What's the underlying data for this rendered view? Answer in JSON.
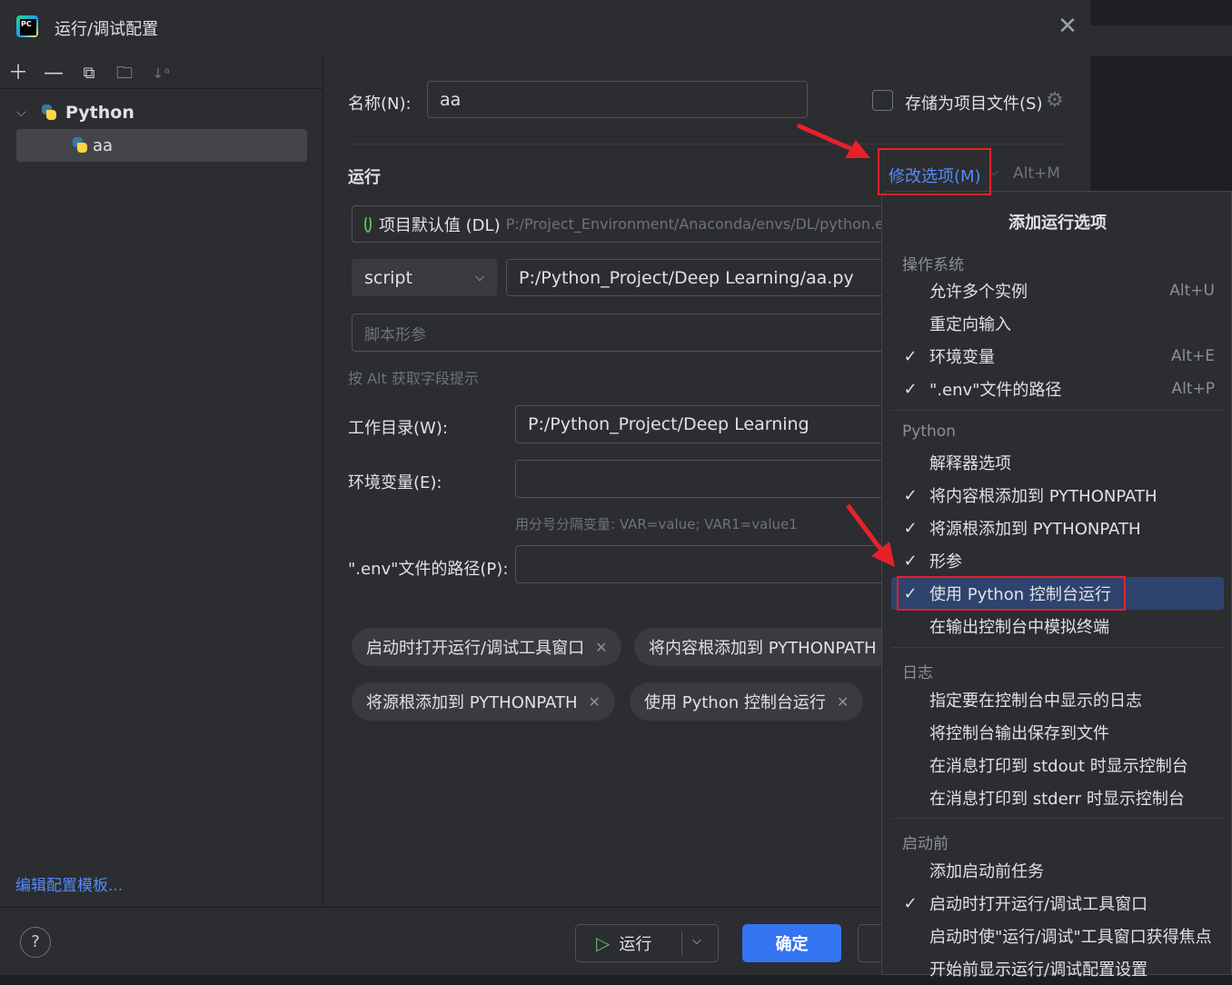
{
  "window": {
    "title": "运行/调试配置"
  },
  "tree": {
    "group_label": "Python",
    "item_label": "aa",
    "edit_templates_link": "编辑配置模板..."
  },
  "form": {
    "name_label": "名称(N):",
    "name_value": "aa",
    "store_as_file_label": "存储为项目文件(S)",
    "run_section": "运行",
    "modify_options_label": "修改选项(M)",
    "modify_options_shortcut": "Alt+M",
    "interpreter_name": "项目默认值 (DL)",
    "interpreter_path": "P:/Project_Environment/Anaconda/envs/DL/python.e",
    "script_type": "script",
    "script_path": "P:/Python_Project/Deep Learning/aa.py",
    "script_params_placeholder": "脚本形参",
    "alt_hint": "按 Alt 获取字段提示",
    "workdir_label": "工作目录(W):",
    "workdir_value": "P:/Python_Project/Deep Learning",
    "env_label": "环境变量(E):",
    "env_hint": "用分号分隔变量: VAR=value; VAR1=value1",
    "dotenv_label": "\".env\"文件的路径(P):",
    "chips": [
      "启动时打开运行/调试工具窗口",
      "将内容根添加到 PYTHONPATH",
      "将源根添加到 PYTHONPATH",
      "使用 Python 控制台运行"
    ]
  },
  "footer": {
    "help": "?",
    "run_button": "运行",
    "ok_button": "确定"
  },
  "popup": {
    "title": "添加运行选项",
    "groups": [
      {
        "name": "操作系统",
        "items": [
          {
            "label": "允许多个实例",
            "checked": false,
            "shortcut": "Alt+U"
          },
          {
            "label": "重定向输入",
            "checked": false,
            "shortcut": ""
          },
          {
            "label": "环境变量",
            "checked": true,
            "shortcut": "Alt+E"
          },
          {
            "label": "\".env\"文件的路径",
            "checked": true,
            "shortcut": "Alt+P"
          }
        ]
      },
      {
        "name": "Python",
        "items": [
          {
            "label": "解释器选项",
            "checked": false,
            "shortcut": ""
          },
          {
            "label": "将内容根添加到 PYTHONPATH",
            "checked": true,
            "shortcut": ""
          },
          {
            "label": "将源根添加到 PYTHONPATH",
            "checked": true,
            "shortcut": ""
          },
          {
            "label": "形参",
            "checked": true,
            "shortcut": ""
          },
          {
            "label": "使用 Python 控制台运行",
            "checked": true,
            "shortcut": ""
          },
          {
            "label": "在输出控制台中模拟终端",
            "checked": false,
            "shortcut": ""
          }
        ]
      },
      {
        "name": "日志",
        "items": [
          {
            "label": "指定要在控制台中显示的日志",
            "checked": false,
            "shortcut": ""
          },
          {
            "label": "将控制台输出保存到文件",
            "checked": false,
            "shortcut": ""
          },
          {
            "label": "在消息打印到 stdout 时显示控制台",
            "checked": false,
            "shortcut": ""
          },
          {
            "label": "在消息打印到 stderr 时显示控制台",
            "checked": false,
            "shortcut": ""
          }
        ]
      },
      {
        "name": "启动前",
        "items": [
          {
            "label": "添加启动前任务",
            "checked": false,
            "shortcut": ""
          },
          {
            "label": "启动时打开运行/调试工具窗口",
            "checked": true,
            "shortcut": ""
          },
          {
            "label": "启动时使\"运行/调试\"工具窗口获得焦点",
            "checked": false,
            "shortcut": ""
          },
          {
            "label": "开始前显示运行/调试配置设置",
            "checked": false,
            "shortcut": ""
          }
        ]
      }
    ]
  }
}
